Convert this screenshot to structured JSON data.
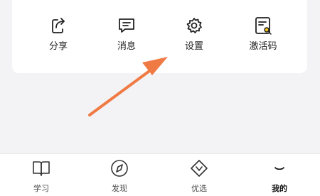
{
  "quick_actions": [
    {
      "label": "分享",
      "icon": "share-icon"
    },
    {
      "label": "消息",
      "icon": "message-icon"
    },
    {
      "label": "设置",
      "icon": "gear-icon"
    },
    {
      "label": "激活码",
      "icon": "activation-code-icon"
    }
  ],
  "annotation": {
    "arrow_color": "#f07a44",
    "points_to": "设置"
  },
  "tabbar": {
    "active": "我的",
    "tabs": [
      {
        "label": "学习",
        "icon": "book-icon"
      },
      {
        "label": "发现",
        "icon": "compass-icon"
      },
      {
        "label": "优选",
        "icon": "diamond-icon"
      },
      {
        "label": "我的",
        "icon": "profile-icon"
      }
    ]
  }
}
